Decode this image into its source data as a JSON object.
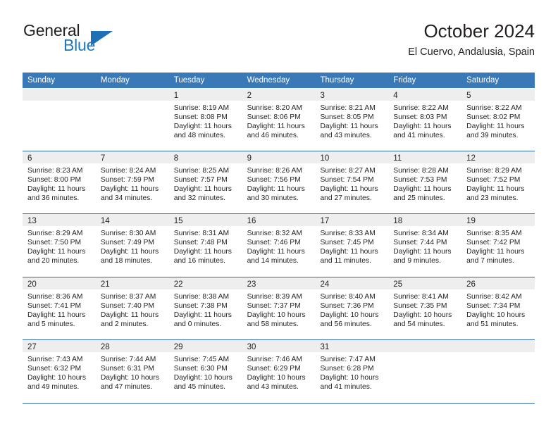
{
  "brand": {
    "word_general": "General",
    "word_blue": "Blue",
    "triangle_color": "#1f6fb5",
    "blue_color": "#1f78c1"
  },
  "header": {
    "title": "October 2024",
    "subtitle": "El Cuervo, Andalusia, Spain"
  },
  "theme": {
    "header_blue": "#3a79b8",
    "row_separator": "#2f6ca8",
    "daynum_band": "#eeeeee",
    "text": "#231f20"
  },
  "calendar": {
    "weekday_headers": [
      "Sunday",
      "Monday",
      "Tuesday",
      "Wednesday",
      "Thursday",
      "Friday",
      "Saturday"
    ],
    "weeks": [
      [
        {
          "day": "",
          "sunrise": "",
          "sunset": "",
          "daylight_line1": "",
          "daylight_line2": ""
        },
        {
          "day": "",
          "sunrise": "",
          "sunset": "",
          "daylight_line1": "",
          "daylight_line2": ""
        },
        {
          "day": "1",
          "sunrise": "Sunrise: 8:19 AM",
          "sunset": "Sunset: 8:08 PM",
          "daylight_line1": "Daylight: 11 hours",
          "daylight_line2": "and 48 minutes."
        },
        {
          "day": "2",
          "sunrise": "Sunrise: 8:20 AM",
          "sunset": "Sunset: 8:06 PM",
          "daylight_line1": "Daylight: 11 hours",
          "daylight_line2": "and 46 minutes."
        },
        {
          "day": "3",
          "sunrise": "Sunrise: 8:21 AM",
          "sunset": "Sunset: 8:05 PM",
          "daylight_line1": "Daylight: 11 hours",
          "daylight_line2": "and 43 minutes."
        },
        {
          "day": "4",
          "sunrise": "Sunrise: 8:22 AM",
          "sunset": "Sunset: 8:03 PM",
          "daylight_line1": "Daylight: 11 hours",
          "daylight_line2": "and 41 minutes."
        },
        {
          "day": "5",
          "sunrise": "Sunrise: 8:22 AM",
          "sunset": "Sunset: 8:02 PM",
          "daylight_line1": "Daylight: 11 hours",
          "daylight_line2": "and 39 minutes."
        }
      ],
      [
        {
          "day": "6",
          "sunrise": "Sunrise: 8:23 AM",
          "sunset": "Sunset: 8:00 PM",
          "daylight_line1": "Daylight: 11 hours",
          "daylight_line2": "and 36 minutes."
        },
        {
          "day": "7",
          "sunrise": "Sunrise: 8:24 AM",
          "sunset": "Sunset: 7:59 PM",
          "daylight_line1": "Daylight: 11 hours",
          "daylight_line2": "and 34 minutes."
        },
        {
          "day": "8",
          "sunrise": "Sunrise: 8:25 AM",
          "sunset": "Sunset: 7:57 PM",
          "daylight_line1": "Daylight: 11 hours",
          "daylight_line2": "and 32 minutes."
        },
        {
          "day": "9",
          "sunrise": "Sunrise: 8:26 AM",
          "sunset": "Sunset: 7:56 PM",
          "daylight_line1": "Daylight: 11 hours",
          "daylight_line2": "and 30 minutes."
        },
        {
          "day": "10",
          "sunrise": "Sunrise: 8:27 AM",
          "sunset": "Sunset: 7:54 PM",
          "daylight_line1": "Daylight: 11 hours",
          "daylight_line2": "and 27 minutes."
        },
        {
          "day": "11",
          "sunrise": "Sunrise: 8:28 AM",
          "sunset": "Sunset: 7:53 PM",
          "daylight_line1": "Daylight: 11 hours",
          "daylight_line2": "and 25 minutes."
        },
        {
          "day": "12",
          "sunrise": "Sunrise: 8:29 AM",
          "sunset": "Sunset: 7:52 PM",
          "daylight_line1": "Daylight: 11 hours",
          "daylight_line2": "and 23 minutes."
        }
      ],
      [
        {
          "day": "13",
          "sunrise": "Sunrise: 8:29 AM",
          "sunset": "Sunset: 7:50 PM",
          "daylight_line1": "Daylight: 11 hours",
          "daylight_line2": "and 20 minutes."
        },
        {
          "day": "14",
          "sunrise": "Sunrise: 8:30 AM",
          "sunset": "Sunset: 7:49 PM",
          "daylight_line1": "Daylight: 11 hours",
          "daylight_line2": "and 18 minutes."
        },
        {
          "day": "15",
          "sunrise": "Sunrise: 8:31 AM",
          "sunset": "Sunset: 7:48 PM",
          "daylight_line1": "Daylight: 11 hours",
          "daylight_line2": "and 16 minutes."
        },
        {
          "day": "16",
          "sunrise": "Sunrise: 8:32 AM",
          "sunset": "Sunset: 7:46 PM",
          "daylight_line1": "Daylight: 11 hours",
          "daylight_line2": "and 14 minutes."
        },
        {
          "day": "17",
          "sunrise": "Sunrise: 8:33 AM",
          "sunset": "Sunset: 7:45 PM",
          "daylight_line1": "Daylight: 11 hours",
          "daylight_line2": "and 11 minutes."
        },
        {
          "day": "18",
          "sunrise": "Sunrise: 8:34 AM",
          "sunset": "Sunset: 7:44 PM",
          "daylight_line1": "Daylight: 11 hours",
          "daylight_line2": "and 9 minutes."
        },
        {
          "day": "19",
          "sunrise": "Sunrise: 8:35 AM",
          "sunset": "Sunset: 7:42 PM",
          "daylight_line1": "Daylight: 11 hours",
          "daylight_line2": "and 7 minutes."
        }
      ],
      [
        {
          "day": "20",
          "sunrise": "Sunrise: 8:36 AM",
          "sunset": "Sunset: 7:41 PM",
          "daylight_line1": "Daylight: 11 hours",
          "daylight_line2": "and 5 minutes."
        },
        {
          "day": "21",
          "sunrise": "Sunrise: 8:37 AM",
          "sunset": "Sunset: 7:40 PM",
          "daylight_line1": "Daylight: 11 hours",
          "daylight_line2": "and 2 minutes."
        },
        {
          "day": "22",
          "sunrise": "Sunrise: 8:38 AM",
          "sunset": "Sunset: 7:38 PM",
          "daylight_line1": "Daylight: 11 hours",
          "daylight_line2": "and 0 minutes."
        },
        {
          "day": "23",
          "sunrise": "Sunrise: 8:39 AM",
          "sunset": "Sunset: 7:37 PM",
          "daylight_line1": "Daylight: 10 hours",
          "daylight_line2": "and 58 minutes."
        },
        {
          "day": "24",
          "sunrise": "Sunrise: 8:40 AM",
          "sunset": "Sunset: 7:36 PM",
          "daylight_line1": "Daylight: 10 hours",
          "daylight_line2": "and 56 minutes."
        },
        {
          "day": "25",
          "sunrise": "Sunrise: 8:41 AM",
          "sunset": "Sunset: 7:35 PM",
          "daylight_line1": "Daylight: 10 hours",
          "daylight_line2": "and 54 minutes."
        },
        {
          "day": "26",
          "sunrise": "Sunrise: 8:42 AM",
          "sunset": "Sunset: 7:34 PM",
          "daylight_line1": "Daylight: 10 hours",
          "daylight_line2": "and 51 minutes."
        }
      ],
      [
        {
          "day": "27",
          "sunrise": "Sunrise: 7:43 AM",
          "sunset": "Sunset: 6:32 PM",
          "daylight_line1": "Daylight: 10 hours",
          "daylight_line2": "and 49 minutes."
        },
        {
          "day": "28",
          "sunrise": "Sunrise: 7:44 AM",
          "sunset": "Sunset: 6:31 PM",
          "daylight_line1": "Daylight: 10 hours",
          "daylight_line2": "and 47 minutes."
        },
        {
          "day": "29",
          "sunrise": "Sunrise: 7:45 AM",
          "sunset": "Sunset: 6:30 PM",
          "daylight_line1": "Daylight: 10 hours",
          "daylight_line2": "and 45 minutes."
        },
        {
          "day": "30",
          "sunrise": "Sunrise: 7:46 AM",
          "sunset": "Sunset: 6:29 PM",
          "daylight_line1": "Daylight: 10 hours",
          "daylight_line2": "and 43 minutes."
        },
        {
          "day": "31",
          "sunrise": "Sunrise: 7:47 AM",
          "sunset": "Sunset: 6:28 PM",
          "daylight_line1": "Daylight: 10 hours",
          "daylight_line2": "and 41 minutes."
        },
        {
          "day": "",
          "sunrise": "",
          "sunset": "",
          "daylight_line1": "",
          "daylight_line2": ""
        },
        {
          "day": "",
          "sunrise": "",
          "sunset": "",
          "daylight_line1": "",
          "daylight_line2": ""
        }
      ]
    ]
  }
}
